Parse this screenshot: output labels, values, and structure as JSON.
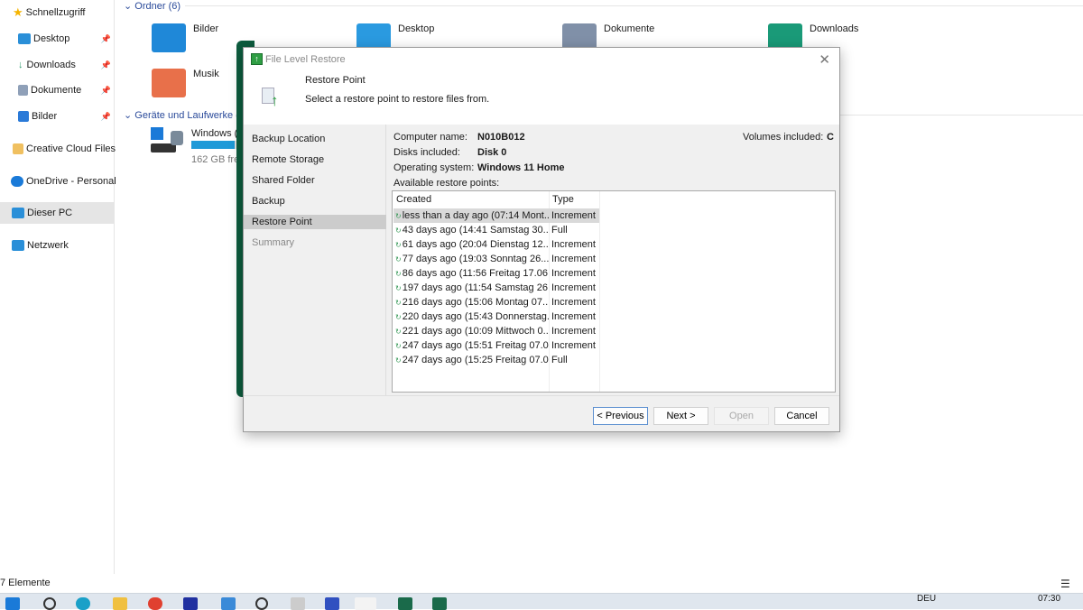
{
  "explorer": {
    "sidebar": [
      {
        "label": "Schnellzugriff",
        "pinned": false
      },
      {
        "label": "Desktop",
        "pinned": true
      },
      {
        "label": "Downloads",
        "pinned": true
      },
      {
        "label": "Dokumente",
        "pinned": true
      },
      {
        "label": "Bilder",
        "pinned": true
      },
      {
        "label": "Creative Cloud Files",
        "pinned": false
      },
      {
        "label": "OneDrive - Personal",
        "pinned": false
      },
      {
        "label": "Dieser PC",
        "pinned": false,
        "selected": true
      },
      {
        "label": "Netzwerk",
        "pinned": false
      }
    ],
    "folders_header": "Ordner (6)",
    "folders": [
      "Bilder",
      "Desktop",
      "Dokumente",
      "Downloads",
      "Musik"
    ],
    "drives_header": "Geräte und Laufwerke (",
    "drive": {
      "name": "Windows (",
      "free": "162 GB fre",
      "usage_fraction": 0.6
    },
    "status": "7 Elemente"
  },
  "taskbar": {
    "lang": "DEU",
    "time": "07:30"
  },
  "dialog": {
    "title": "File Level Restore",
    "header_title": "Restore Point",
    "header_desc": "Select a restore point to restore files from.",
    "nav": [
      {
        "label": "Backup Location"
      },
      {
        "label": "Remote Storage"
      },
      {
        "label": "Shared Folder"
      },
      {
        "label": "Backup"
      },
      {
        "label": "Restore Point",
        "selected": true
      },
      {
        "label": "Summary",
        "disabled": true
      }
    ],
    "computer_name_label": "Computer name:",
    "computer_name": "N010B012",
    "disks_label": "Disks included:",
    "disks": "Disk 0",
    "os_label": "Operating system:",
    "os": "Windows 11 Home",
    "volumes_label": "Volumes included:",
    "volumes": "C",
    "available_label": "Available restore points:",
    "columns": [
      "Created",
      "Type"
    ],
    "rows": [
      [
        "less than a day ago (07:14 Mont...",
        "Increment"
      ],
      [
        "43 days ago (14:41 Samstag 30....",
        "Full"
      ],
      [
        "61 days ago (20:04 Dienstag 12....",
        "Increment"
      ],
      [
        "77 days ago (19:03 Sonntag 26....",
        "Increment"
      ],
      [
        "86 days ago (11:56 Freitag 17.06...",
        "Increment"
      ],
      [
        "197 days ago (11:54 Samstag 26...",
        "Increment"
      ],
      [
        "216 days ago (15:06 Montag 07....",
        "Increment"
      ],
      [
        "220 days ago (15:43 Donnerstag...",
        "Increment"
      ],
      [
        "221 days ago (10:09 Mittwoch 0...",
        "Increment"
      ],
      [
        "247 days ago (15:51 Freitag 07.0...",
        "Increment"
      ],
      [
        "247 days ago (15:25 Freitag 07.0...",
        "Full"
      ]
    ],
    "buttons": {
      "previous": "< Previous",
      "next": "Next >",
      "open": "Open",
      "cancel": "Cancel"
    }
  }
}
